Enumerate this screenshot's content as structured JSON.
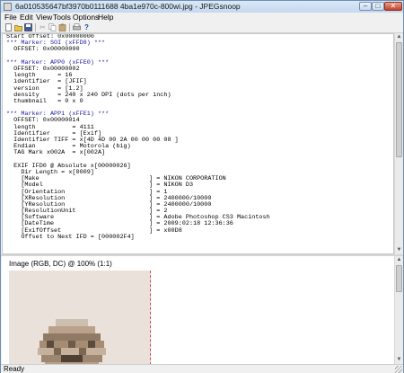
{
  "window": {
    "title": "6a010535647bf3970b0111688 4ba1e970c-800wi.jpg - JPEGsnoop"
  },
  "menu": [
    "File",
    "Edit",
    "View",
    "Tools",
    "Options",
    "Help"
  ],
  "toolbar": {
    "icons": [
      "new-icon",
      "open-icon",
      "save-icon",
      "cut-icon",
      "copy-icon",
      "paste-icon",
      "print-icon",
      "help-icon"
    ]
  },
  "log_lines": [
    {
      "text": "Start Offset: 0x00000000",
      "kind": "plain"
    },
    {
      "text": "*** Marker: SOI (xFFD8) ***",
      "kind": "marker"
    },
    {
      "text": "  OFFSET: 0x00000000",
      "kind": "plain"
    },
    {
      "text": "",
      "kind": "plain"
    },
    {
      "text": "*** Marker: APP0 (xFFE0) ***",
      "kind": "marker"
    },
    {
      "text": "  OFFSET: 0x00000002",
      "kind": "plain"
    },
    {
      "text": "  length      = 16",
      "kind": "plain"
    },
    {
      "text": "  identifier  = [JFIF]",
      "kind": "plain"
    },
    {
      "text": "  version     = [1.2]",
      "kind": "plain"
    },
    {
      "text": "  density     = 240 x 240 DPI (dots per inch)",
      "kind": "plain"
    },
    {
      "text": "  thumbnail   = 0 x 0",
      "kind": "plain"
    },
    {
      "text": "",
      "kind": "plain"
    },
    {
      "text": "*** Marker: APP1 (xFFE1) ***",
      "kind": "marker"
    },
    {
      "text": "  OFFSET: 0x00000014",
      "kind": "plain"
    },
    {
      "text": "  length          = 4111",
      "kind": "plain"
    },
    {
      "text": "  Identifier      = [Exif]",
      "kind": "plain"
    },
    {
      "text": "  Identifier TIFF = x[4D 4D 00 2A 00 00 00 08 ]",
      "kind": "plain"
    },
    {
      "text": "  Endian          = Motorola (big)",
      "kind": "plain"
    },
    {
      "text": "  TAG Mark x002A  = x[002A]",
      "kind": "plain"
    },
    {
      "text": "",
      "kind": "plain"
    },
    {
      "text": "  EXIF IFD0 @ Absolute x[00000026]",
      "kind": "plain"
    },
    {
      "text": "    Dir Length = x[0009]",
      "kind": "plain"
    },
    {
      "text": "    [Make                              ] = NIKON CORPORATION",
      "kind": "plain"
    },
    {
      "text": "    [Model                             ] = NIKON D3",
      "kind": "plain"
    },
    {
      "text": "    [Orientation                       ] = 1",
      "kind": "plain"
    },
    {
      "text": "    [XResolution                       ] = 2400000/10000",
      "kind": "plain"
    },
    {
      "text": "    [YResolution                       ] = 2400000/10000",
      "kind": "plain"
    },
    {
      "text": "    [ResolutionUnit                    ] = 2",
      "kind": "plain"
    },
    {
      "text": "    [Software                          ] = Adobe Photoshop CS3 Macintosh",
      "kind": "plain"
    },
    {
      "text": "    [DateTime                          ] = 2009:02:18 12:36:36",
      "kind": "plain"
    },
    {
      "text": "    [ExifOffset                        ] = x00D8",
      "kind": "plain"
    },
    {
      "text": "    Offset to Next IFD = [000002F4]",
      "kind": "plain"
    }
  ],
  "image_pane": {
    "caption": "Image (RGB, DC) @ 100% (1:1)"
  },
  "status": {
    "text": "Ready"
  },
  "colors": {
    "marker_text": "#1a1aa0",
    "titlebar": "#c4d8ee"
  }
}
